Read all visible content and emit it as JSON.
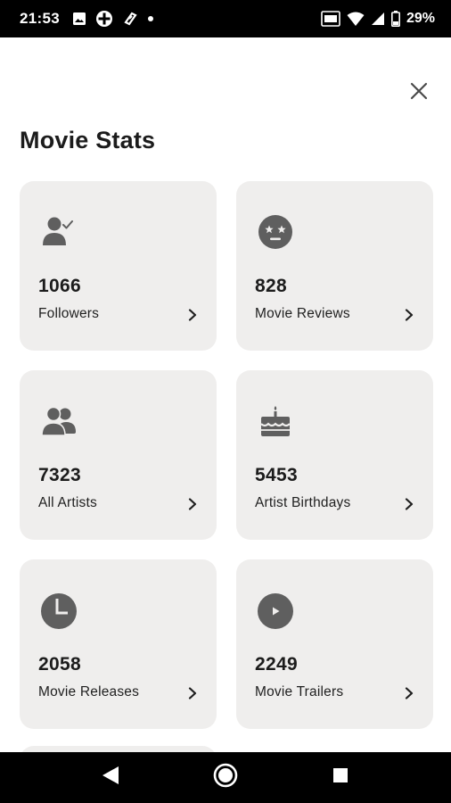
{
  "status_bar": {
    "time": "21:53",
    "battery_text": "29%",
    "left_icons": [
      "image-icon",
      "game-controller-icon",
      "link-icon",
      "dot-icon"
    ],
    "right_icons": [
      "volte-icon",
      "wifi-icon",
      "signal-icon",
      "battery-icon"
    ]
  },
  "header": {
    "title": "Movie Stats",
    "close_icon": "close-icon"
  },
  "stats": [
    {
      "value": "1066",
      "label": "Followers",
      "icon": "user-check-icon"
    },
    {
      "value": "828",
      "label": "Movie Reviews",
      "icon": "star-eyes-face-icon"
    },
    {
      "value": "7323",
      "label": "All Artists",
      "icon": "group-icon"
    },
    {
      "value": "5453",
      "label": "Artist Birthdays",
      "icon": "cake-icon"
    },
    {
      "value": "2058",
      "label": "Movie Releases",
      "icon": "clock-icon"
    },
    {
      "value": "2249",
      "label": "Movie Trailers",
      "icon": "play-circle-icon"
    }
  ],
  "nav_bar": {
    "back_icon": "back-triangle-icon",
    "home_icon": "home-circle-icon",
    "recents_icon": "recents-square-icon"
  },
  "colors": {
    "card_background": "#efeeed",
    "icon_gray": "#5f5f5f",
    "text_dark": "#1c1c1c",
    "bar_black": "#000000"
  }
}
